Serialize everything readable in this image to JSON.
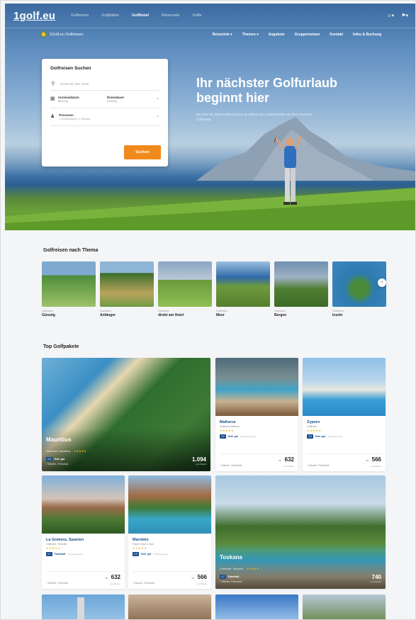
{
  "header": {
    "logo": "1golf.eu",
    "nav": [
      "Golfreisen",
      "Golfplätze",
      "Golfhotel",
      "Reiseziele",
      "Golfe"
    ],
    "active_nav": "Golfhotel",
    "icons": [
      "user-icon",
      "flag-icon"
    ]
  },
  "subheader": {
    "brand": "1Golf.eu Golfreisen",
    "nav": [
      "Reiseziele ▾",
      "Themen ▾",
      "Angebote",
      "Gruppenreisen",
      "Kontakt",
      "Infos & Buchung"
    ]
  },
  "search": {
    "title": "Golfreisen Suchen",
    "placeholder": "Reiseziel oder Hotel",
    "arrival_label": "Anreisedatum",
    "arrival_value": "Beliebig",
    "duration_label": "Reisedauer",
    "duration_value": "Beliebig",
    "persons_label": "Personen",
    "persons_value": "2 Erwachsene, 1 Zimmer",
    "button": "Suchen"
  },
  "hero": {
    "title": "Ihr nächster Golfurlaub beginnt hier",
    "subtitle": "Mit mehr als 3000 Golfangeboten im Inland und Ausland finden Sie Ihren Wunsch-Golfurlaub"
  },
  "themes": {
    "title": "Golfreisen nach Thema",
    "items": [
      {
        "small": "Golfreisen",
        "name": "Günstig",
        "color1": "#4e8d3a",
        "color2": "#9cc26a"
      },
      {
        "small": "Golfreisen",
        "name": "Anfänger",
        "color1": "#3a6e2c",
        "color2": "#b9a45d"
      },
      {
        "small": "Golfreisen",
        "name": "direkt am Hotel",
        "color1": "#8aa6c4",
        "color2": "#6b9a3b"
      },
      {
        "small": "Golfreisen",
        "name": "Meer",
        "color1": "#2f6aa8",
        "color2": "#6e9a3e"
      },
      {
        "small": "Golfreisen",
        "name": "Bergen",
        "color1": "#6f8fb0",
        "color2": "#4f7f32"
      },
      {
        "small": "Golfreisen",
        "name": "Inseln",
        "color1": "#2e7bb0",
        "color2": "#4a8c3a"
      }
    ]
  },
  "packages": {
    "title": "Top Golfpakete",
    "mauritius": {
      "name": "Mauritius",
      "location": "Golfhotel, Mauritius",
      "stars": "★★★★★",
      "score": "4,6",
      "word": "Sehr gut",
      "detail": "7 Nächte, Frühstück",
      "price": "1.094",
      "pp": "pro Person"
    },
    "mallorca": {
      "name": "Mallorca",
      "location": "Golfhotel Mallorca",
      "stars": "★★★★★",
      "score": "4,5",
      "word": "Sehr gut",
      "reviews": "63 Bewertungen",
      "detail": "7 Nächte, Frühstück",
      "from": "ab",
      "price": "632",
      "pp": "pro Person"
    },
    "zypern": {
      "name": "Zypern",
      "location": "Golfhotel",
      "stars": "★★★★★",
      "score": "4,5",
      "word": "Sehr gut",
      "reviews": "41 Bewertungen",
      "detail": "7 Nächte, Frühstück",
      "from": "ab",
      "price": "566",
      "pp": "pro Person"
    },
    "lagomera": {
      "name": "La Gomera, Spanien",
      "location": "Golfhotel, Teneriffa",
      "stars": "★★★★★",
      "score": "4,7",
      "word": "Fabelhaft",
      "reviews": "22 Bewertungen",
      "detail": "7 Nächte, Frühstück",
      "from": "ab",
      "price": "632",
      "pp": "pro Person"
    },
    "marokko": {
      "name": "Marokko",
      "location": "Palme Hotel & Spa",
      "stars": "★★★★★",
      "score": "4,5",
      "word": "Sehr gut",
      "reviews": "30 Bewertungen",
      "detail": "7 Nächte, Frühstück",
      "from": "ab",
      "price": "566",
      "pp": "pro Person"
    },
    "toskana": {
      "name": "Toskana",
      "location": "Golfhotel, Toskana",
      "stars": "★★★★★",
      "score": "4,7",
      "word": "Fabelhaft",
      "detail": "7 Nächte, Frühstück",
      "price": "740",
      "pp": "pro Person"
    }
  }
}
